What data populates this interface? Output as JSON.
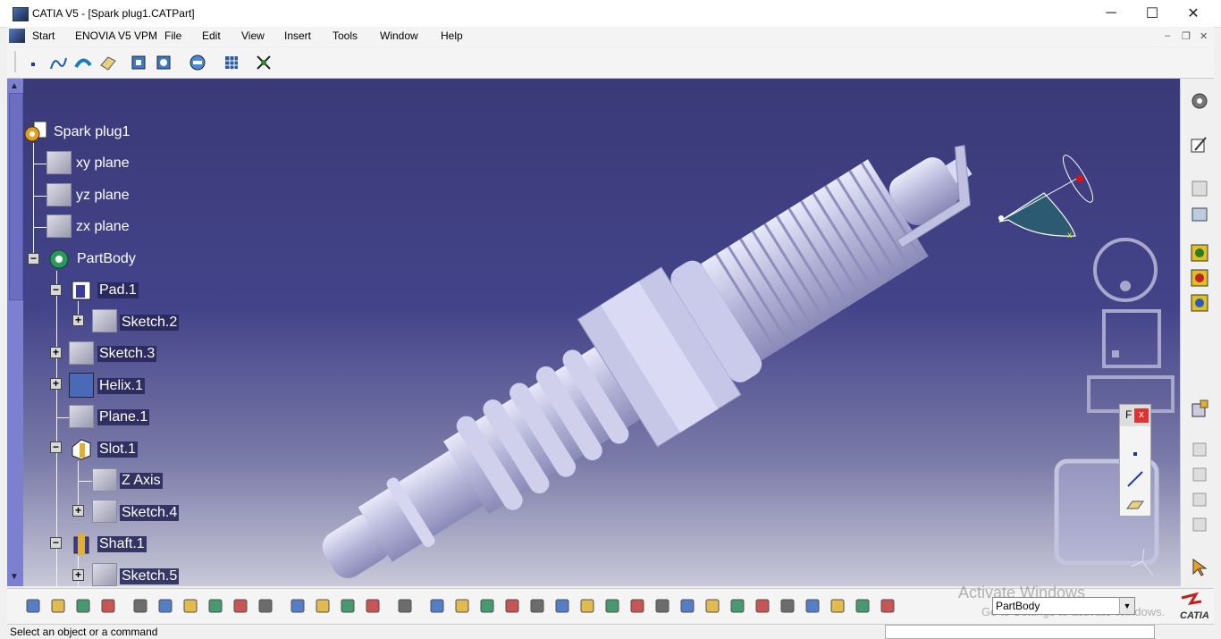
{
  "window": {
    "title": "CATIA V5 - [Spark plug1.CATPart]",
    "controls": {
      "minimize": "─",
      "maximize": "☐",
      "close": "✕"
    }
  },
  "menubar": {
    "items": [
      {
        "label": "Start"
      },
      {
        "label": "ENOVIA V5 VPM"
      },
      {
        "label": "File"
      },
      {
        "label": "Edit"
      },
      {
        "label": "View"
      },
      {
        "label": "Insert"
      },
      {
        "label": "Tools"
      },
      {
        "label": "Window"
      },
      {
        "label": "Help"
      }
    ],
    "doc_controls": {
      "minimize": "–",
      "restore": "❐",
      "close": "✕"
    }
  },
  "tree": {
    "root": "Spark plug1",
    "nodes": {
      "xy": "xy plane",
      "yz": "yz plane",
      "zx": "zx plane",
      "partbody": "PartBody",
      "pad1": "Pad.1",
      "sketch2": "Sketch.2",
      "sketch3": "Sketch.3",
      "helix1": "Helix.1",
      "plane1": "Plane.1",
      "slot1": "Slot.1",
      "zaxis": "Z Axis",
      "sketch4": "Sketch.4",
      "shaft1": "Shaft.1",
      "sketch5": "Sketch.5"
    }
  },
  "floating_toolbar": {
    "title": "F",
    "close": "x"
  },
  "bottom": {
    "current_body": "PartBody",
    "status": "Select an object or a command",
    "watermark_title": "Activate Windows",
    "watermark_sub": "Go to Settings to activate Windows.",
    "brand": "CATIA"
  },
  "colors": {
    "viewport_top": "#3a3a78",
    "viewport_bottom": "#c9c9d8",
    "part": "#c8c8e6",
    "tree_selection": "#28285a"
  },
  "icons": {
    "toolbar_top": [
      "point-icon",
      "spline-icon",
      "sweep-icon",
      "plane-icon",
      "boolean-add-icon",
      "boolean-remove-icon",
      "analysis-icon",
      "grid-icon",
      "snap-icon"
    ],
    "toolbar_bottom": [
      "new-icon",
      "open-icon",
      "save-icon",
      "print-icon",
      "cut-icon",
      "copy-icon",
      "paste-icon",
      "undo-icon",
      "redo-icon",
      "help-icon",
      "macro-icon",
      "measure-icon",
      "parameter-icon",
      "bottle-icon",
      "capture-icon",
      "fit-all-icon",
      "fly-icon",
      "pan-icon",
      "rotate-icon",
      "zoom-in-icon",
      "zoom-out-icon",
      "normal-view-icon",
      "multiview-icon",
      "iso-view-icon",
      "shading-icon",
      "hide-show-icon",
      "swap-icon",
      "update-icon",
      "spin-icon",
      "axis-icon",
      "units-icon",
      "stack-icon",
      "list-icon",
      "body-icon"
    ]
  }
}
